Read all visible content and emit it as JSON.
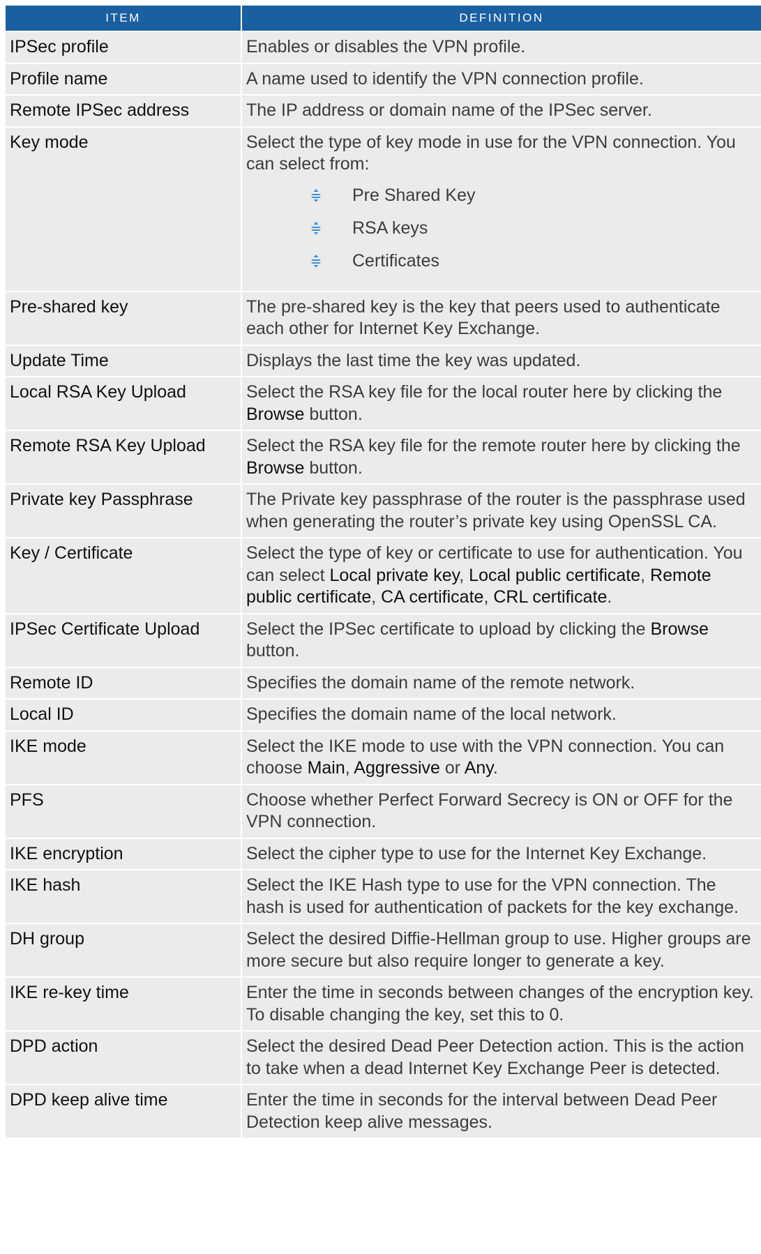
{
  "header": {
    "item": "ITEM",
    "definition": "DEFINITION"
  },
  "colors": {
    "header_bg": "#1a5fa0",
    "row_bg": "#ebebeb",
    "bullet": "#3b8fd6"
  },
  "rows": [
    {
      "item": "IPSec profile",
      "def": [
        {
          "t": "Enables or disables the VPN profile."
        }
      ]
    },
    {
      "item": "Profile name",
      "def": [
        {
          "t": "A name used to identify the VPN connection profile."
        }
      ]
    },
    {
      "item": "Remote IPSec address",
      "def": [
        {
          "t": "The IP address or domain name of the IPSec server."
        }
      ]
    },
    {
      "item": "Key mode",
      "def": [
        {
          "t": "Select the type of key mode in use for the VPN connection. You can select from:"
        }
      ],
      "options": [
        "Pre Shared Key",
        "RSA keys",
        "Certificates"
      ],
      "option_icon": "diamond-bullet-icon"
    },
    {
      "item": "Pre-shared key",
      "def": [
        {
          "t": "The pre-shared key is the key that peers used to authenticate each other for Internet Key Exchange."
        }
      ]
    },
    {
      "item": "Update Time",
      "def": [
        {
          "t": "Displays the last time the key was updated."
        }
      ]
    },
    {
      "item": "Local RSA Key Upload",
      "def": [
        {
          "t": "Select the RSA key file for the local router here by clicking the "
        },
        {
          "t": "Browse",
          "b": true
        },
        {
          "t": " button."
        }
      ]
    },
    {
      "item": "Remote RSA Key Upload",
      "def": [
        {
          "t": "Select the RSA key file for the remote router here by clicking the "
        },
        {
          "t": "Browse",
          "b": true
        },
        {
          "t": " button."
        }
      ]
    },
    {
      "item": "Private key Passphrase",
      "def": [
        {
          "t": "The Private key passphrase of the router is the passphrase used when generating the router’s private key using OpenSSL CA."
        }
      ]
    },
    {
      "item": "Key / Certificate",
      "def": [
        {
          "t": "Select the type of key or certificate to use for authentication. You can select "
        },
        {
          "t": "Local private key",
          "b": true
        },
        {
          "t": ", "
        },
        {
          "t": "Local public certificate",
          "b": true
        },
        {
          "t": ", "
        },
        {
          "t": "Remote public certificate",
          "b": true
        },
        {
          "t": ", "
        },
        {
          "t": "CA certificate",
          "b": true
        },
        {
          "t": ", "
        },
        {
          "t": "CRL certificate",
          "b": true
        },
        {
          "t": "."
        }
      ]
    },
    {
      "item": "IPSec Certificate Upload",
      "def": [
        {
          "t": "Select the IPSec certificate to upload by clicking the "
        },
        {
          "t": "Browse",
          "b": true
        },
        {
          "t": " button."
        }
      ]
    },
    {
      "item": "Remote ID",
      "def": [
        {
          "t": "Specifies the domain name of the remote network."
        }
      ]
    },
    {
      "item": "Local ID",
      "def": [
        {
          "t": "Specifies the domain name of the local network."
        }
      ]
    },
    {
      "item": "IKE mode",
      "def": [
        {
          "t": "Select the IKE mode to use with the VPN connection. You can choose "
        },
        {
          "t": "Main",
          "b": true
        },
        {
          "t": ", "
        },
        {
          "t": "Aggressive",
          "b": true
        },
        {
          "t": " or "
        },
        {
          "t": "Any",
          "b": true
        },
        {
          "t": "."
        }
      ]
    },
    {
      "item": "PFS",
      "def": [
        {
          "t": "Choose whether Perfect Forward Secrecy is ON or OFF for the VPN connection."
        }
      ]
    },
    {
      "item": "IKE encryption",
      "def": [
        {
          "t": "Select the cipher type to use for the Internet Key Exchange."
        }
      ]
    },
    {
      "item": "IKE hash",
      "def": [
        {
          "t": "Select the IKE Hash type to use for the VPN connection. The hash is used for authentication of packets for the key exchange."
        }
      ]
    },
    {
      "item": "DH group",
      "def": [
        {
          "t": "Select the desired Diffie-Hellman group to use. Higher groups are more secure but also require longer to generate a key."
        }
      ]
    },
    {
      "item": "IKE re-key time",
      "def": [
        {
          "t": "Enter the time in seconds between changes of the encryption key. To disable changing the key, set this to 0."
        }
      ]
    },
    {
      "item": "DPD action",
      "def": [
        {
          "t": "Select the desired Dead Peer Detection action. This is the action to take when a dead Internet Key Exchange Peer is detected."
        }
      ]
    },
    {
      "item": "DPD keep alive time",
      "def": [
        {
          "t": "Enter the time in seconds for the interval between Dead Peer Detection keep alive messages."
        }
      ]
    }
  ]
}
